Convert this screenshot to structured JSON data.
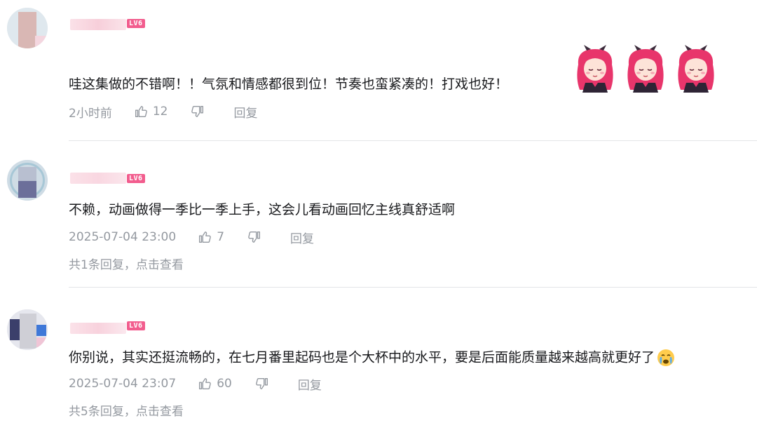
{
  "comments": [
    {
      "level": "LV6",
      "text": "哇这集做的不错啊！！气氛和情感都很到位！节奏也蛮紧凑的！打戏也好！",
      "time": "2小时前",
      "likes": "12",
      "reply_label": "回复",
      "stickers": [
        "pink-hair-girl-sticker",
        "pink-hair-girl-sticker",
        "pink-hair-girl-sticker"
      ]
    },
    {
      "level": "LV6",
      "text": "不赖，动画做得一季比一季上手，这会儿看动画回忆主线真舒适啊",
      "time": "2025-07-04 23:00",
      "likes": "7",
      "reply_label": "回复",
      "sub_replies": "共1条回复，点击查看"
    },
    {
      "level": "LV6",
      "text": "你别说，其实还挺流畅的，在七月番里起码也是个大杯中的水平，要是后面能质量越来越高就更好了",
      "emoji": "crying-face-emoji",
      "time": "2025-07-04 23:07",
      "likes": "60",
      "reply_label": "回复",
      "sub_replies": "共5条回复，点击查看"
    }
  ],
  "colors": {
    "level_badge": "#f25d8e",
    "meta_text": "#9499a0",
    "divider": "#e3e5e7"
  }
}
